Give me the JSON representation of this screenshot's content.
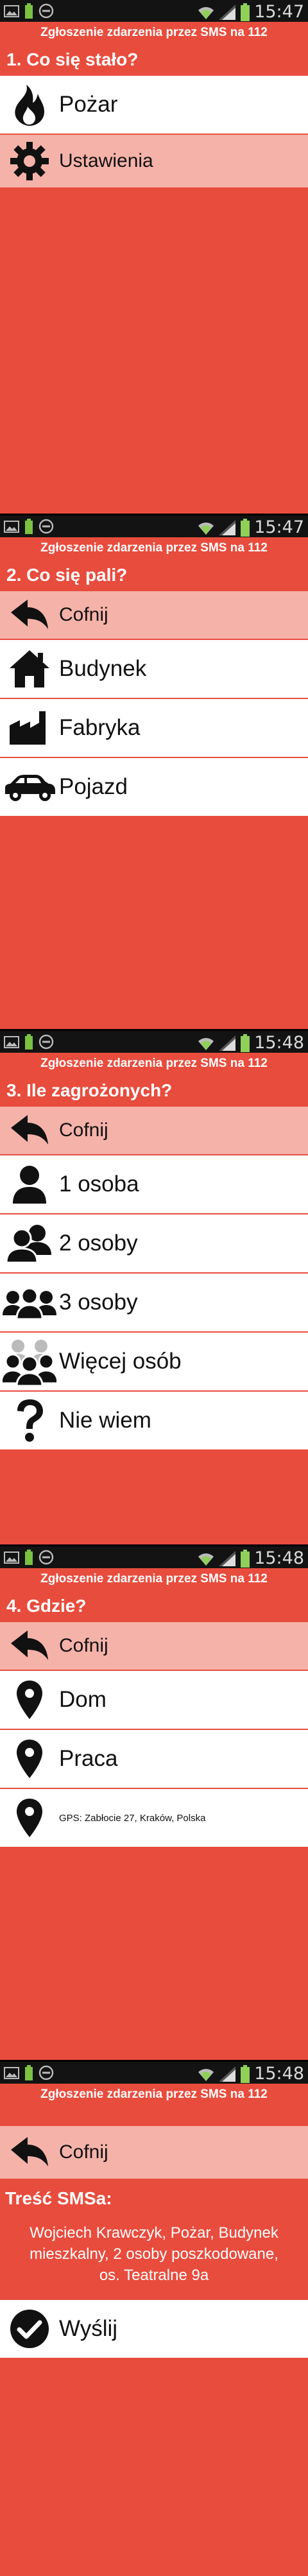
{
  "status_bar": {
    "time_1": "15:47",
    "time_2": "15:47",
    "time_3": "15:48",
    "time_4": "15:48",
    "time_5": "15:48"
  },
  "app_title": "Zgłoszenie zdarzenia przez SMS na 112",
  "colors": {
    "background": "#e84c3d",
    "highlight": "#f5b2a9",
    "item": "#ffffff"
  },
  "step1": {
    "question": "1. Co się stało?",
    "items": [
      {
        "label": "Pożar",
        "icon": "fire-icon"
      },
      {
        "label": "Ustawienia",
        "icon": "gear-icon"
      }
    ]
  },
  "step2": {
    "question": "2. Co się pali?",
    "back": "Cofnij",
    "items": [
      {
        "label": "Budynek",
        "icon": "house-icon"
      },
      {
        "label": "Fabryka",
        "icon": "factory-icon"
      },
      {
        "label": "Pojazd",
        "icon": "car-icon"
      }
    ]
  },
  "step3": {
    "question": "3. Ile zagrożonych?",
    "back": "Cofnij",
    "items": [
      {
        "label": "1 osoba",
        "icon": "person-icon"
      },
      {
        "label": "2 osoby",
        "icon": "two-persons-icon"
      },
      {
        "label": "3 osoby",
        "icon": "three-persons-icon"
      },
      {
        "label": "Więcej osób",
        "icon": "crowd-icon"
      },
      {
        "label": "Nie wiem",
        "icon": "question-icon"
      }
    ]
  },
  "step4": {
    "question": "4. Gdzie?",
    "back": "Cofnij",
    "items": [
      {
        "label": "Dom",
        "icon": "pin-icon"
      },
      {
        "label": "Praca",
        "icon": "pin-icon"
      },
      {
        "label": "GPS: Zabłocie 27, Kraków, Polska",
        "icon": "gps-pin-icon"
      }
    ]
  },
  "step5": {
    "back": "Cofnij",
    "sms_heading": "Treść SMSa:",
    "sms_text": "Wojciech Krawczyk, Pożar, Budynek mieszkalny, 2 osoby poszkodowane, os. Teatralne 9a",
    "send": "Wyślij"
  }
}
